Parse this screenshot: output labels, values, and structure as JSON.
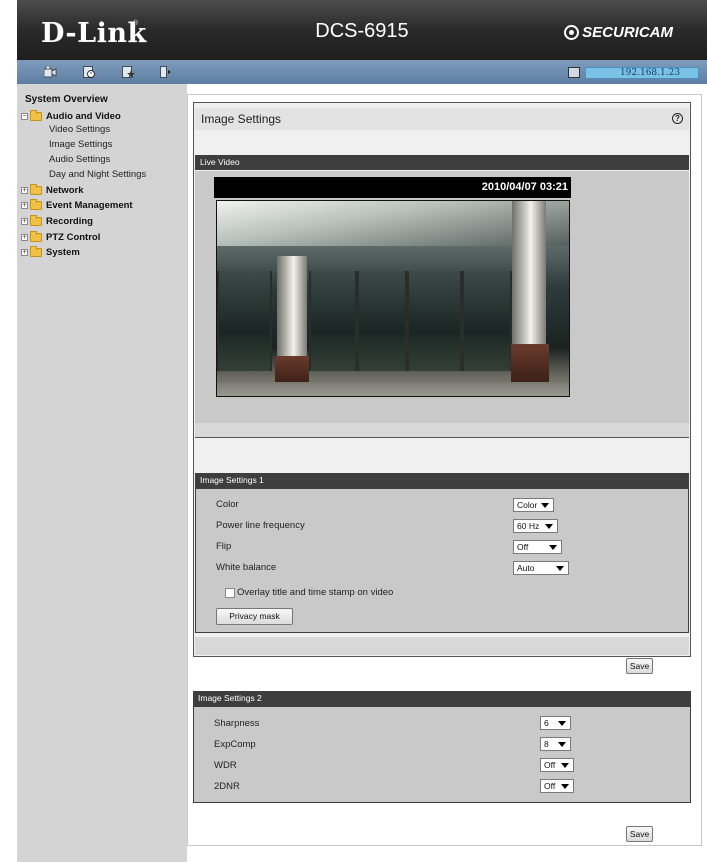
{
  "header": {
    "brand": "D-Link",
    "brand_mark": "®",
    "model": "DCS-6915",
    "logo_text": "SECURICAM"
  },
  "toolbar": {
    "icons": [
      "camera-live-icon",
      "setup-clock-icon",
      "star-maintenance-icon",
      "logout-door-icon"
    ],
    "ip": "192.168.1.23"
  },
  "sidebar": {
    "title": "System Overview",
    "groups": [
      {
        "label": "Audio and Video",
        "expanded": true,
        "items": [
          "Video Settings",
          "Image Settings",
          "Audio Settings",
          "Day and Night Settings"
        ]
      },
      {
        "label": "Network"
      },
      {
        "label": "Event Management"
      },
      {
        "label": "Recording"
      },
      {
        "label": "PTZ Control"
      },
      {
        "label": "System"
      }
    ]
  },
  "main": {
    "title": "Image Settings",
    "help_symbol": "?",
    "live_video": {
      "heading": "Live Video",
      "timestamp": "2010/04/07 03:21"
    },
    "settings1": {
      "heading": "Image Settings 1",
      "rows": [
        {
          "label": "Color",
          "value": "Color"
        },
        {
          "label": "Power line frequency",
          "value": "60 Hz"
        },
        {
          "label": "Flip",
          "value": "Off"
        },
        {
          "label": "White balance",
          "value": "Auto"
        }
      ],
      "overlay_label": "Overlay title and time stamp on video",
      "overlay_checked": false,
      "privacy_button": "Privacy mask"
    },
    "save_label": "Save",
    "settings2": {
      "heading": "Image Settings 2",
      "rows": [
        {
          "label": "Sharpness",
          "value": "6"
        },
        {
          "label": "ExpComp",
          "value": "8"
        },
        {
          "label": "WDR",
          "value": "Off"
        },
        {
          "label": "2DNR",
          "value": "Off"
        }
      ]
    }
  },
  "colors": {
    "header_bg": "#2a2a2a",
    "toolbar_bg": "#6b8bb0",
    "sidebar_bg": "#d4d4d4",
    "section_head": "#3e3e3e",
    "panel_bg": "#c9c9c9"
  }
}
